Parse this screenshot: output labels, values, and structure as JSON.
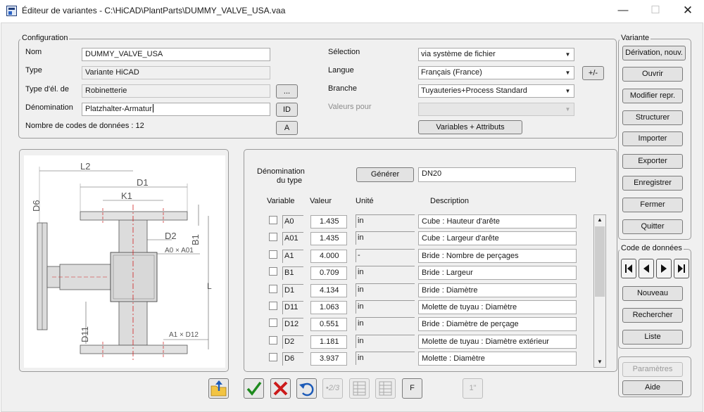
{
  "window": {
    "title": "Éditeur de variantes - C:\\HiCAD\\PlantParts\\DUMMY_VALVE_USA.vaa",
    "minimize": "—",
    "maximize": "☐",
    "close": "✕"
  },
  "configuration": {
    "legend": "Configuration",
    "nom_label": "Nom",
    "nom_value": "DUMMY_VALVE_USA",
    "type_label": "Type",
    "type_value": "Variante HiCAD",
    "type_el_label": "Type d'él. de",
    "type_el_value": "Robinetterie",
    "type_el_button": "...",
    "denom_label": "Dénomination",
    "denom_value": "Platzhalter-Armatur",
    "denom_button": "ID",
    "count_text": "Nombre de codes de données : 12",
    "count_button": "A",
    "selection_label": "Sélection",
    "selection_value": "via système de fichier",
    "langue_label": "Langue",
    "langue_value": "Français (France)",
    "langue_button": "+/-",
    "branche_label": "Branche",
    "branche_value": "Tuyauteries+Process Standard",
    "valeurs_label": "Valeurs pour",
    "valeurs_value": "",
    "variables_button": "Variables + Attributs"
  },
  "variante": {
    "legend": "Variante",
    "buttons": [
      "Dérivation, nouv.",
      "Ouvrir",
      "Modifier repr.",
      "Structurer",
      "Importer",
      "Exporter",
      "Enregistrer",
      "Fermer",
      "Quitter"
    ]
  },
  "code_donnees": {
    "legend": "Code de données",
    "buttons": [
      "Nouveau",
      "Rechercher",
      "Liste"
    ]
  },
  "bottom_right": {
    "parametres": "Paramètres",
    "aide": "Aide"
  },
  "drawing": {
    "labels": [
      "L2",
      "D1",
      "K1",
      "D6",
      "D2",
      "B1",
      "A0 × A01",
      "L",
      "D11",
      "A1 × D12"
    ]
  },
  "table": {
    "denom_type_label_1": "Dénomination",
    "denom_type_label_2": "du type",
    "generer_button": "Générer",
    "denom_type_value": "DN20",
    "headers": {
      "variable": "Variable",
      "valeur": "Valeur",
      "unite": "Unité",
      "description": "Description"
    },
    "rows": [
      {
        "variable": "A0",
        "value": "1.435",
        "unit": "in",
        "description": "Cube : Hauteur d'arête"
      },
      {
        "variable": "A01",
        "value": "1.435",
        "unit": "in",
        "description": "Cube : Largeur d'arête"
      },
      {
        "variable": "A1",
        "value": "4.000",
        "unit": "-",
        "description": "Bride : Nombre de perçages"
      },
      {
        "variable": "B1",
        "value": "0.709",
        "unit": "in",
        "description": "Bride : Largeur"
      },
      {
        "variable": "D1",
        "value": "4.134",
        "unit": "in",
        "description": "Bride : Diamètre"
      },
      {
        "variable": "D11",
        "value": "1.063",
        "unit": "in",
        "description": "Molette de tuyau : Diamètre"
      },
      {
        "variable": "D12",
        "value": "0.551",
        "unit": "in",
        "description": "Bride : Diamètre de perçage"
      },
      {
        "variable": "D2",
        "value": "1.181",
        "unit": "in",
        "description": "Molette de tuyau : Diamètre extérieur"
      },
      {
        "variable": "D6",
        "value": "3.937",
        "unit": "in",
        "description": "Molette : Diamètre"
      }
    ]
  },
  "toolbar": {
    "f_label": "F",
    "one_label": "1\"",
    "fraction_label": "•2/3"
  },
  "colors": {
    "accept_green": "#1e8a1e",
    "reject_red": "#cc1a1a",
    "undo_blue": "#1d5bb8",
    "folder_yellow": "#f2c443"
  }
}
